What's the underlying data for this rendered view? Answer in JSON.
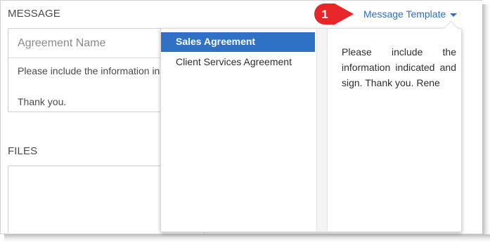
{
  "message_section": {
    "label": "MESSAGE",
    "agreement_name_placeholder": "Agreement Name",
    "body_line1": "Please include the information in",
    "body_line2": "Thank you."
  },
  "files_section": {
    "label": "FILES"
  },
  "callout": {
    "number": "1",
    "color": "#e8262a"
  },
  "template": {
    "link_label": "Message Template",
    "items": [
      {
        "label": "Sales Agreement",
        "selected": true
      },
      {
        "label": "Client Services Agreement",
        "selected": false
      }
    ],
    "preview_text": "Please include the information indicated and sign. Thank you. Rene"
  },
  "colors": {
    "accent": "#2f72c5",
    "link": "#2e6fc0",
    "callout": "#e8262a"
  }
}
